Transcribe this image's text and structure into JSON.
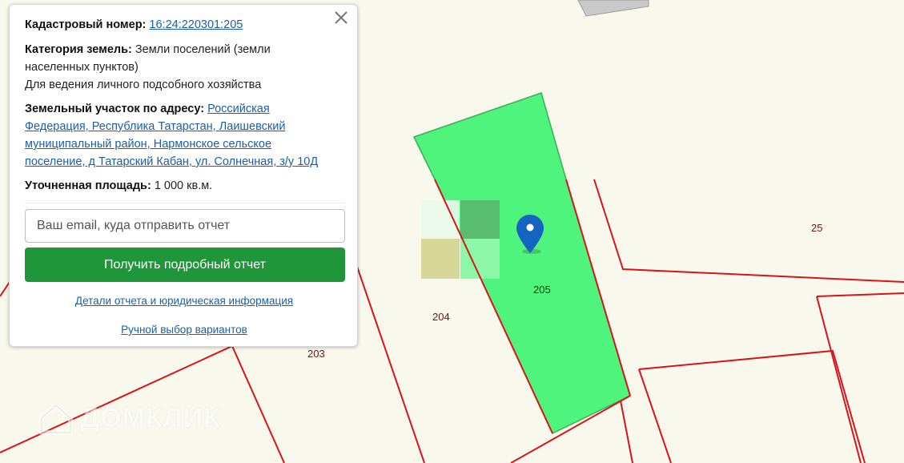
{
  "map": {
    "parcels": {
      "main": "205",
      "west": "204",
      "southwest": "203",
      "east": "25"
    },
    "colors": {
      "selected_parcel": "#4ff47c",
      "parcel_border": "#d8141a",
      "marker": "#1565c0",
      "background": "#f8f8ec"
    },
    "watermark": "ДОМКЛИК",
    "marker_icon": "location-pin-icon"
  },
  "popup": {
    "close_icon": "close-icon",
    "cadastral_label": "Кадастровый номер:",
    "cadastral_number": "16:24:220301:205",
    "category_label": "Категория земель:",
    "category_value": "Земли поселений (земли",
    "category_value_line2": "населенных пунктов)",
    "usage": "Для ведения личного подсобного хозяйства",
    "address_label": "Земельный участок по адресу:",
    "address_line1": "Российская",
    "address_line2": "Федерация, Республика Татарстан, Лаишевский",
    "address_line3": "муниципальный район, Нармонское сельское",
    "address_line4": "поселение, д Татарский Кабан, ул. Солнечная, з/у 10Д",
    "area_label": "Уточненная площадь:",
    "area_value": "1 000 кв.м.",
    "email_placeholder": "Ваш email, куда отправить отчет",
    "report_button": "Получить подробный отчет",
    "details_link": "Детали отчета и юридическая информация",
    "manual_link": "Ручной выбор вариантов"
  }
}
